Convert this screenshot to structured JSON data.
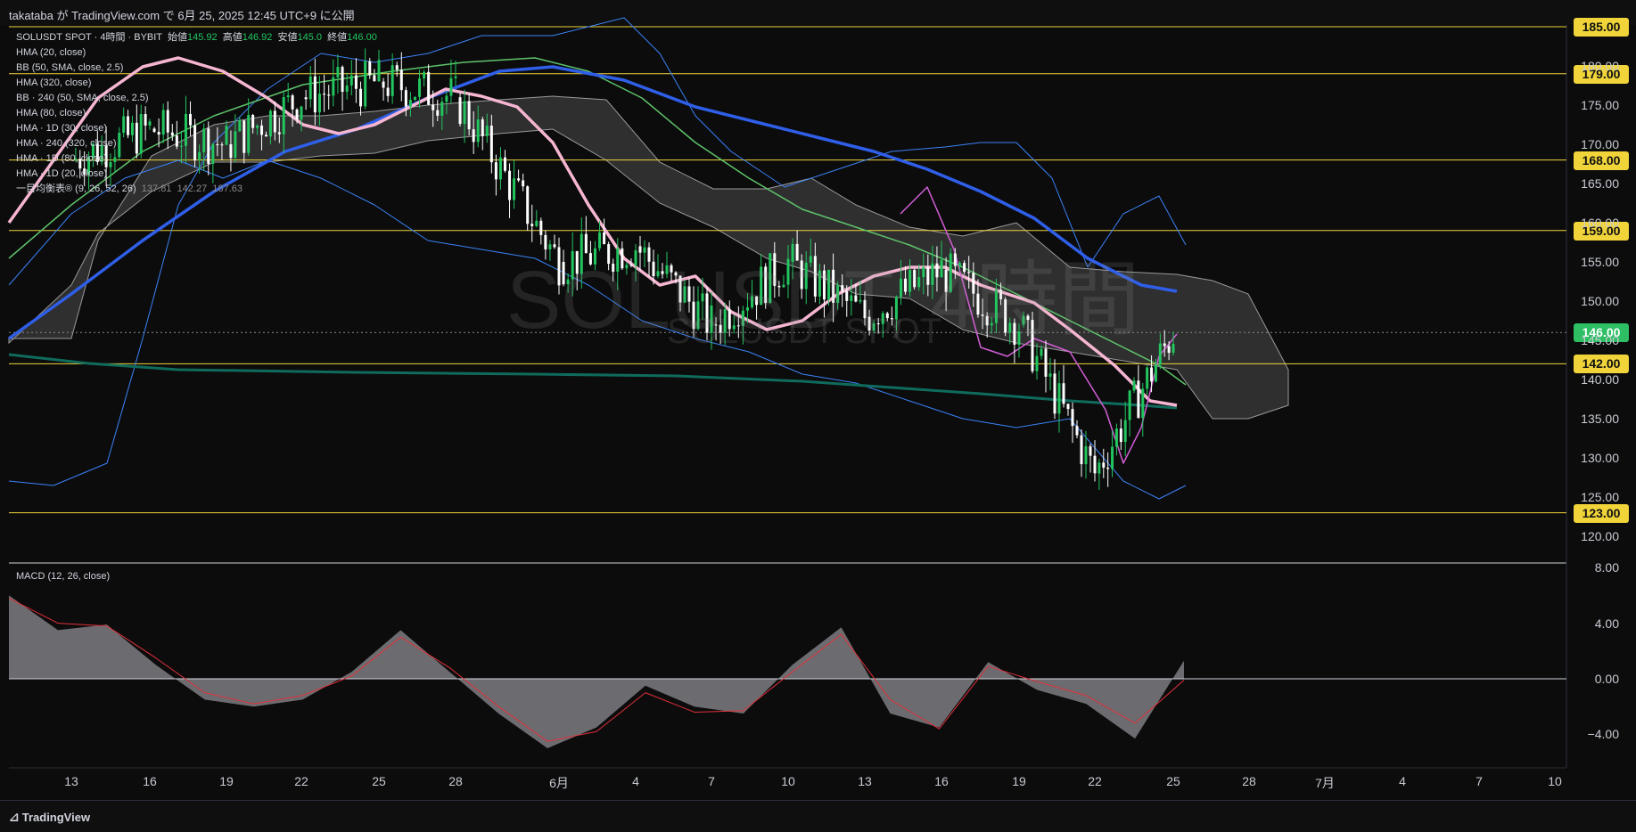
{
  "header": {
    "publish_text": "takataba が TradingView.com で 6月 25, 2025 12:45 UTC+9 に公開"
  },
  "legend": {
    "symbol_line": {
      "symbol": "SOLUSDT SPOT · 4時間 · BYBIT",
      "open_label": "始値",
      "open": "145.92",
      "high_label": "高値",
      "high": "146.92",
      "low_label": "安値",
      "low": "145.0",
      "close_label": "終値",
      "close": "146.00"
    },
    "indicators": [
      "HMA (20, close)",
      "BB (50, SMA, close, 2.5)",
      "HMA (320, close)",
      "BB · 240 (50, SMA, close, 2.5)",
      "HMA (80, close)",
      "HMA · 1D (30, close)",
      "HMA · 240 (320, close)",
      "HMA · 1D (80, close)",
      "HMA · 1D (20, close)",
      "一目均衡表® (9, 26, 52, 26)"
    ],
    "ichimoku_values": [
      "137.81",
      "142.27",
      "187.63"
    ]
  },
  "watermark": {
    "main": "SOLUSDT, 4時間",
    "sub": "SOLUSDT SPOT"
  },
  "price_tags": [
    {
      "value": "185.00",
      "price": 185,
      "kind": "level"
    },
    {
      "value": "179.00",
      "price": 179,
      "kind": "level"
    },
    {
      "value": "168.00",
      "price": 168,
      "kind": "level"
    },
    {
      "value": "159.00",
      "price": 159,
      "kind": "level"
    },
    {
      "value": "146.00",
      "price": 146,
      "kind": "current"
    },
    {
      "value": "142.00",
      "price": 142,
      "kind": "level"
    },
    {
      "value": "123.00",
      "price": 123,
      "kind": "level"
    }
  ],
  "macd_label": "MACD (12, 26, close)",
  "footer": {
    "brand": "TradingView"
  },
  "colors": {
    "level_line": "#f0d43a",
    "up_candle": "#22c55e",
    "down_candle": "#ffffff",
    "hma_slow_blue": "#2f5fe8",
    "hma_pink": "#f6b6d2",
    "hma_teal": "#0f6b5c",
    "bb_light_blue": "#3b82f6",
    "ichimoku_cloud": "#5a5a5a",
    "macd_signal": "#e0303a",
    "macd_hist": "#8a8a8a"
  },
  "chart_data": [
    {
      "type": "candlestick",
      "title": "SOLUSDT SPOT · 4時間 · BYBIT",
      "ylim": [
        117,
        187
      ],
      "y_ticks": [
        120,
        125,
        130,
        135,
        140,
        145,
        150,
        155,
        160,
        165,
        170,
        175,
        180
      ],
      "y_tick_labels": [
        "120.00",
        "125.00",
        "130.00",
        "135.00",
        "140.00",
        "145.00",
        "150.00",
        "155.00",
        "160.00",
        "165.00",
        "170.00",
        "175.00",
        "180.00"
      ],
      "x_tick_labels": [
        "13",
        "16",
        "19",
        "22",
        "25",
        "28",
        "6月",
        "4",
        "7",
        "10",
        "13",
        "16",
        "19",
        "22",
        "25",
        "28",
        "7月",
        "4",
        "7",
        "10"
      ],
      "horizontal_levels": [
        185,
        179,
        168,
        159,
        142,
        123
      ],
      "current_price": 146.0,
      "close_path": [
        {
          "x": "13",
          "y": 168
        },
        {
          "x": "16",
          "y": 172
        },
        {
          "x": "19",
          "y": 170
        },
        {
          "x": "22",
          "y": 176
        },
        {
          "x": "25",
          "y": 178
        },
        {
          "x": "28",
          "y": 176
        },
        {
          "x": "6月",
          "y": 155
        },
        {
          "x": "4",
          "y": 157
        },
        {
          "x": "7",
          "y": 147
        },
        {
          "x": "10",
          "y": 155
        },
        {
          "x": "13",
          "y": 148
        },
        {
          "x": "16",
          "y": 154
        },
        {
          "x": "19",
          "y": 147
        },
        {
          "x": "22",
          "y": 128
        },
        {
          "x": "25",
          "y": 146
        }
      ]
    },
    {
      "type": "area",
      "title": "MACD (12, 26, close)",
      "ylim": [
        -7,
        8.5
      ],
      "y_ticks": [
        8,
        4,
        0,
        -4
      ],
      "y_tick_labels": [
        "8.00",
        "4.00",
        "0.00",
        "−4.00"
      ],
      "series": [
        {
          "values": [
            6.0,
            3.5,
            3.9,
            1.0,
            -1.5,
            -2.0,
            -1.5,
            0.5,
            3.5,
            0.5,
            -2.5,
            -5.0,
            -3.5,
            -0.5,
            -2.0,
            -2.5,
            1.0,
            3.7,
            -2.5,
            -3.5,
            1.2,
            -0.8,
            -1.8,
            -4.3,
            1.3
          ]
        },
        {
          "values": [
            5.8,
            4.0,
            3.8,
            1.5,
            -1.0,
            -1.8,
            -1.2,
            0.2,
            3.0,
            0.8,
            -2.0,
            -4.5,
            -3.8,
            -1.0,
            -2.4,
            -2.3,
            0.5,
            3.2,
            -1.5,
            -3.6,
            0.9,
            -0.2,
            -1.2,
            -3.2,
            -0.1
          ]
        }
      ]
    }
  ]
}
